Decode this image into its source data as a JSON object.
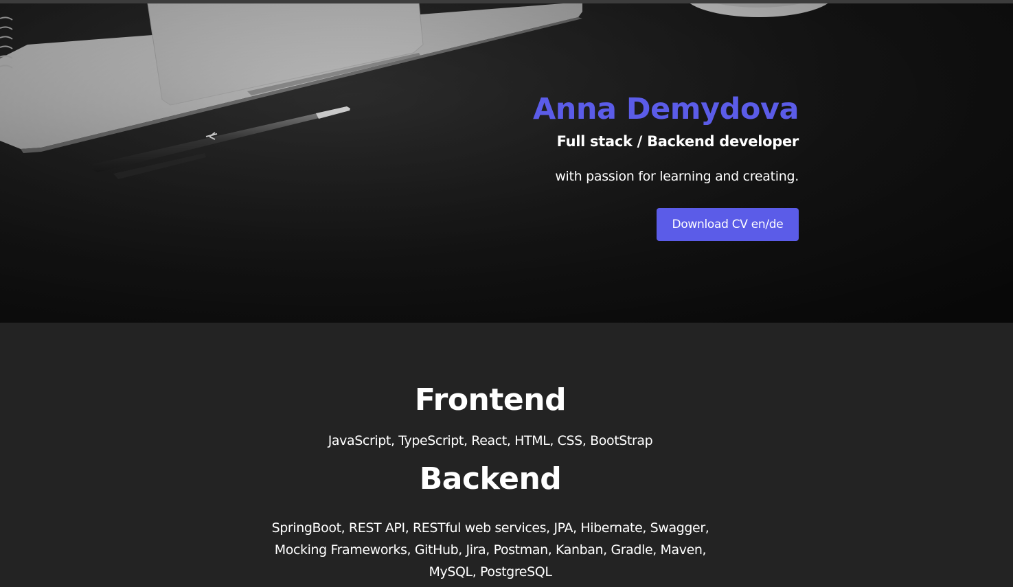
{
  "hero": {
    "name": "Anna Demydova",
    "role": "Full stack / Backend developer",
    "tagline": "with passion for learning and creating.",
    "download_label": "Download CV en/de",
    "background_image": "desk-laptop-pen-photo"
  },
  "skills": {
    "frontend": {
      "title": "Frontend",
      "list": "JavaScript, TypeScript, React, HTML, CSS, BootStrap"
    },
    "backend": {
      "title": "Backend",
      "list": "SpringBoot, REST API, RESTful web services, JPA, Hibernate, Swagger, Mocking Frameworks, GitHub, Jira, Postman, Kanban, Gradle, Maven, MySQL, PostgreSQL"
    }
  },
  "colors": {
    "accent": "#5b5ce8",
    "page_background": "#232323",
    "text": "#ffffff"
  }
}
